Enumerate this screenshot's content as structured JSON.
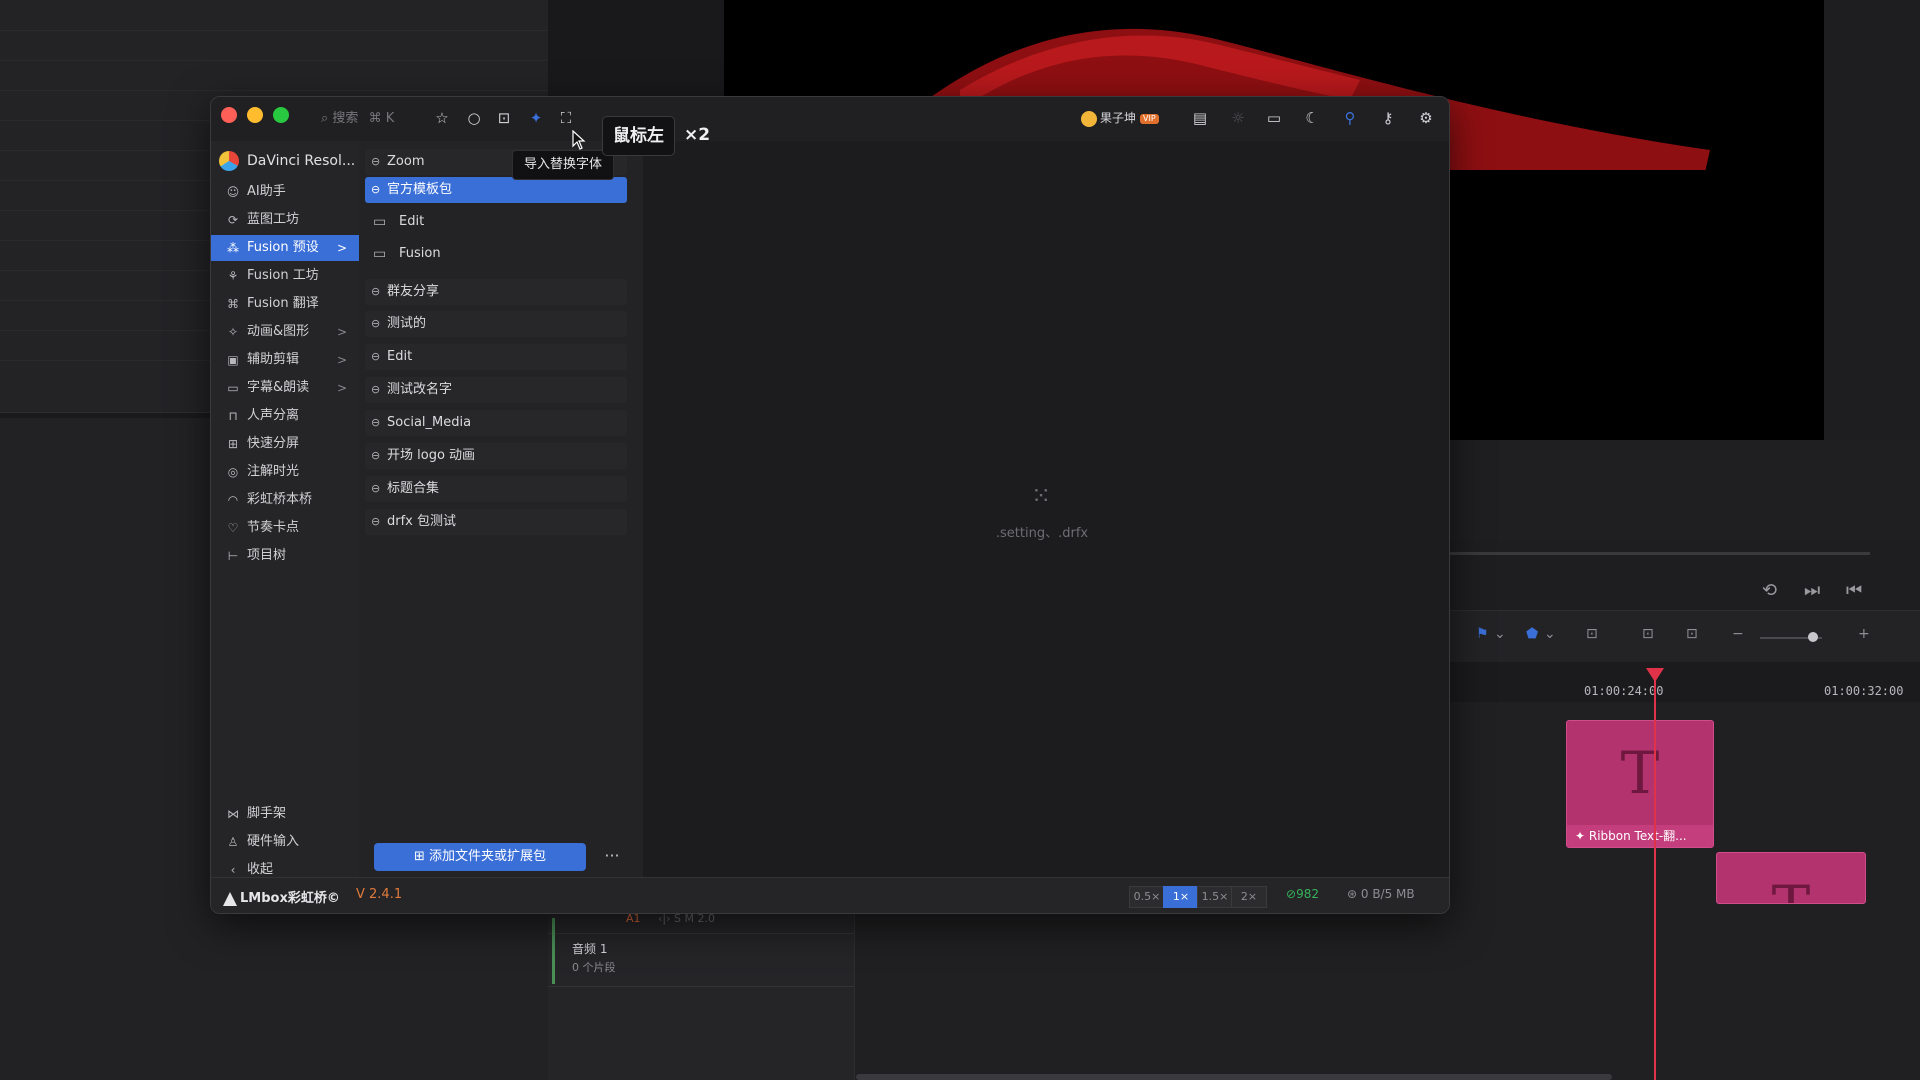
{
  "window": {
    "search_placeholder": "搜索",
    "search_shortcut": "⌘ K",
    "user_name": "果子坤",
    "user_badge": "VIP",
    "app_name": "DaVinci Resol...",
    "tooltip": "导入替换字体",
    "key_overlay": "鼠标左",
    "key_multiplier": "×2"
  },
  "sidebar": {
    "items": [
      {
        "label": "AI助手",
        "icon": "robot-icon"
      },
      {
        "label": "蓝图工坊",
        "icon": "blueprint-icon"
      },
      {
        "label": "Fusion 预设",
        "icon": "grid-dots-icon",
        "active": true,
        "chevron": ">"
      },
      {
        "label": "Fusion 工坊",
        "icon": "nodes-icon"
      },
      {
        "label": "Fusion 翻译",
        "icon": "translate-icon"
      },
      {
        "label": "动画&图形",
        "icon": "sparkle-icon",
        "chevron": ">"
      },
      {
        "label": "辅助剪辑",
        "icon": "film-icon",
        "chevron": ">"
      },
      {
        "label": "字幕&朗读",
        "icon": "subtitle-icon",
        "chevron": ">"
      },
      {
        "label": "人声分离",
        "icon": "lock-icon"
      },
      {
        "label": "快速分屏",
        "icon": "split-grid-icon"
      },
      {
        "label": "注解时光",
        "icon": "pin-icon"
      },
      {
        "label": "彩虹桥本桥",
        "icon": "rainbow-icon"
      },
      {
        "label": "节奏卡点",
        "icon": "heart-icon"
      },
      {
        "label": "项目树",
        "icon": "tree-icon"
      }
    ],
    "bottom": [
      {
        "label": "脚手架",
        "icon": "scaffold-icon"
      },
      {
        "label": "硬件输入",
        "icon": "joystick-icon"
      },
      {
        "label": "收起",
        "icon": "chevron-left-icon"
      }
    ]
  },
  "list": {
    "items": [
      {
        "label": "Zoom",
        "type": "pack"
      },
      {
        "label": "官方模板包",
        "type": "pack",
        "selected": true
      },
      {
        "label": "Edit",
        "type": "folder"
      },
      {
        "label": "Fusion",
        "type": "folder"
      },
      {
        "label": "群友分享",
        "type": "pack"
      },
      {
        "label": "测试的",
        "type": "pack"
      },
      {
        "label": "Edit",
        "type": "pack"
      },
      {
        "label": "测试改名字",
        "type": "pack"
      },
      {
        "label": "Social_Media",
        "type": "pack"
      },
      {
        "label": "开场 logo 动画",
        "type": "pack"
      },
      {
        "label": "标题合集",
        "type": "pack"
      },
      {
        "label": "drfx 包测试",
        "type": "pack"
      }
    ],
    "add_button": "添加文件夹或扩展包",
    "more": "···"
  },
  "content": {
    "empty_hint": ".setting、.drfx"
  },
  "statusbar": {
    "brand": "LMbox彩虹桥©",
    "version": "V 2.4.1",
    "speeds": [
      "0.5×",
      "1×",
      "1.5×",
      "2×"
    ],
    "speed_selected": "1×",
    "count": "982",
    "net": "0 B/5 MB"
  },
  "timeline": {
    "timecodes": [
      "01:00:24:00",
      "01:00:32:00"
    ],
    "clip_title": "Ribbon Text-翻...",
    "clip_glyph": "T",
    "audio_track_name": "音频 1",
    "audio_track_count": "0 个片段",
    "track_label": "A1",
    "track_strip": "‹|›   S   M        2.0"
  },
  "colors": {
    "accent": "#3a6fd8",
    "clip": "#b2336d",
    "playhead": "#e0334a",
    "version": "#e07a3a",
    "count": "#36b35a"
  }
}
